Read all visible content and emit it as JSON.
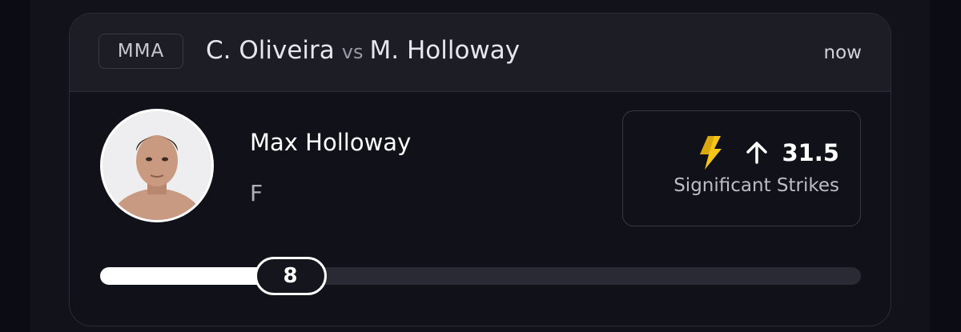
{
  "card": {
    "sport": "MMA",
    "fighter_a": "C. Oliveira",
    "vs": "vs",
    "fighter_b": "M. Holloway",
    "time": "now"
  },
  "player": {
    "name": "Max Holloway",
    "position": "F"
  },
  "stat": {
    "icon": "lightning-bolt-icon",
    "direction_icon": "arrow-up-icon",
    "value": "31.5",
    "label": "Significant Strikes",
    "accent": "#f5c518"
  },
  "slider": {
    "value": "8",
    "fill_fraction": 0.25
  }
}
